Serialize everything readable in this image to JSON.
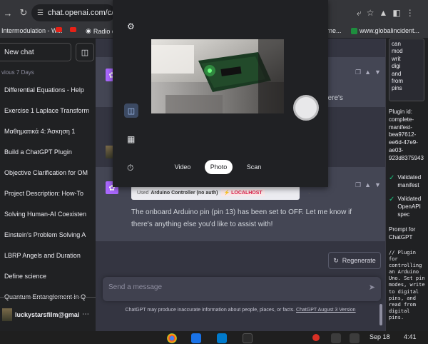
{
  "browser": {
    "url": "chat.openai.com/c/6fc8",
    "bookmarks": [
      {
        "label": "Intermodulation - W..."
      },
      {
        "label": "Radio o"
      },
      {
        "label": "rne..."
      },
      {
        "label": "www.globalincident..."
      }
    ]
  },
  "sidebar": {
    "new_chat": "New chat",
    "section_label": "vious 7 Days",
    "chats": [
      {
        "label": "Differential Equations - Help"
      },
      {
        "label": "Exercise 1 Laplace Transform"
      },
      {
        "label": "Μαθηματικά 4: Άσκηση 1"
      },
      {
        "label": "Build a ChatGPT Plugin"
      },
      {
        "label": "Objective Clarification for OM"
      },
      {
        "label": "Project Description: How-To"
      },
      {
        "label": "Solving Human-AI Coexisten"
      },
      {
        "label": "Einstein's Problem Solving A"
      },
      {
        "label": "LBRP Angels and Duration"
      },
      {
        "label": "Define science"
      },
      {
        "label": "Quantum Entanglement in Q"
      }
    ],
    "user_email": "luckystarsfilm@gmail.c"
  },
  "chat": {
    "partial_text": "here's",
    "plugin_used_prefix": "Used",
    "plugin_name": "Arduino Controller (no auth)",
    "plugin_badge": "LOCALHOST",
    "reply": "The onboard Arduino pin (pin 13) has been set to OFF. Let me know if there's anything else you'd like to assist with!",
    "regenerate_label": "Regenerate",
    "input_placeholder": "Send a message",
    "disclaimer": "ChatGPT may produce inaccurate information about people, places, or facts.",
    "disclaimer_link": "ChatGPT August 3 Version"
  },
  "right_panel": {
    "card_text": "can\nmod\nwrit\ndigi\nand\nfrom\npins",
    "plugin_id_label": "Plugin id:\ncomplete-\nmanifest-\nbea97612-\nee6d-47e9-\nae03-\n923d8375943",
    "checks": [
      {
        "label": "Validated\nmanifest"
      },
      {
        "label": "Validated\nOpenAPI\nspec"
      }
    ],
    "prompt_label": "Prompt for\nChatGPT",
    "prompt_code": "// Plugin\nfor\ncontrolling\nan Arduino\nUno. Set pin\nmodes, write\nto digital\npins, and\nread from\ndigital\npins."
  },
  "camera": {
    "modes": [
      {
        "label": "Video"
      },
      {
        "label": "Photo",
        "active": true
      },
      {
        "label": "Scan"
      }
    ]
  },
  "taskbar": {
    "date": "Sep 18",
    "time": "4:41"
  },
  "colors": {
    "sidebar_bg": "#202123",
    "main_bg": "#343541",
    "assistant_row_bg": "#444654",
    "gpt_logo": "#ab68ff",
    "localhost_badge": "#e11d48",
    "check_green": "#19c37d"
  }
}
